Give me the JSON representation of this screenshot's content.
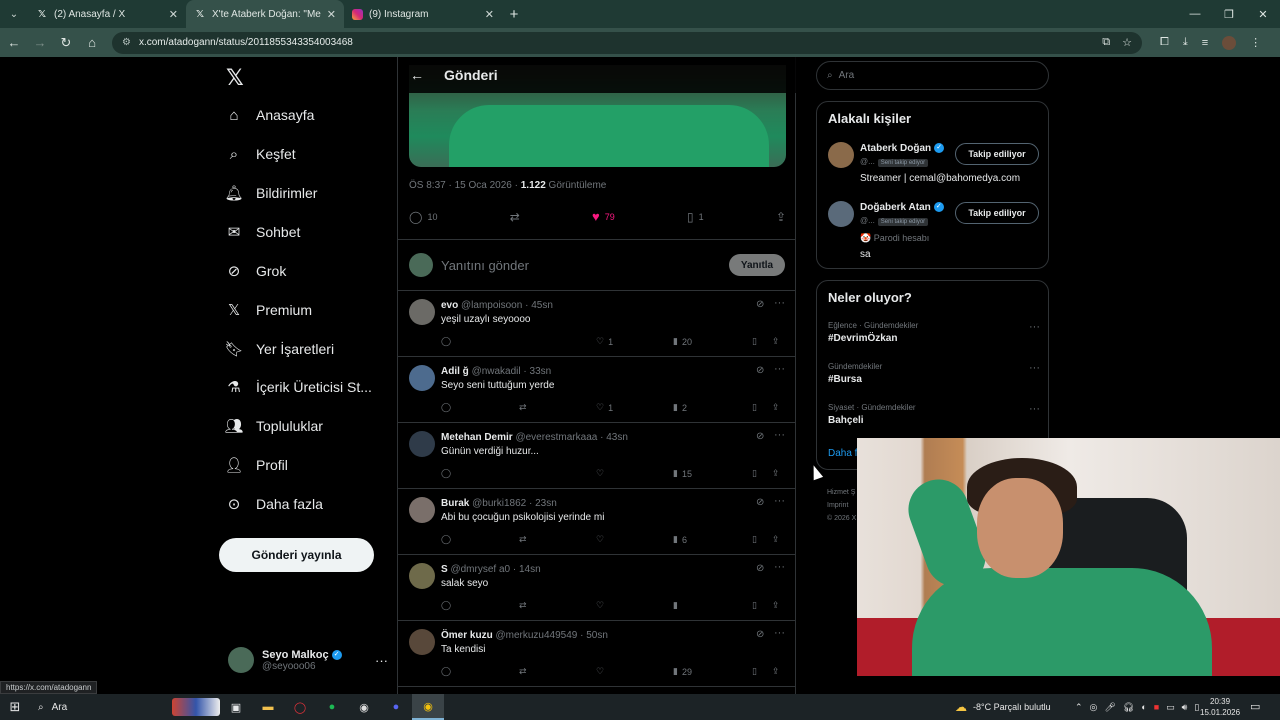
{
  "browser": {
    "tabs": [
      {
        "favicon": "x-logo-icon",
        "title": "(2) Anasayfa / X",
        "active": false
      },
      {
        "favicon": "x-logo-icon",
        "title": "X'te Ataberk Doğan: \"Meşhur A",
        "active": true
      },
      {
        "favicon": "instagram-icon",
        "title": "(9) Instagram",
        "active": false
      }
    ],
    "url": "x.com/atadogann/status/2011855343354003468"
  },
  "nav": {
    "items": [
      {
        "icon": "home-icon",
        "label": "Anasayfa"
      },
      {
        "icon": "search-icon",
        "label": "Keşfet"
      },
      {
        "icon": "bell-icon",
        "label": "Bildirimler"
      },
      {
        "icon": "mail-icon",
        "label": "Sohbet"
      },
      {
        "icon": "grok-icon",
        "label": "Grok"
      },
      {
        "icon": "x-logo-icon",
        "label": "Premium"
      },
      {
        "icon": "bookmark-icon",
        "label": "Yer İşaretleri"
      },
      {
        "icon": "flask-icon",
        "label": "İçerik Üreticisi St..."
      },
      {
        "icon": "people-icon",
        "label": "Topluluklar"
      },
      {
        "icon": "person-icon",
        "label": "Profil"
      },
      {
        "icon": "more-circle-icon",
        "label": "Daha fazla"
      }
    ],
    "post_button": "Gönderi yayınla",
    "account": {
      "name": "Seyo Malkoç",
      "handle": "@seyooo06"
    }
  },
  "main": {
    "title": "Gönderi",
    "post": {
      "time": "ÖS 8:37 · 15 Oca 2026 · ",
      "views": "1.122",
      "views_label": " Görüntüleme",
      "replies": "10",
      "likes": "79",
      "bookmarks": "1"
    },
    "reply_placeholder": "Yanıtını gönder",
    "reply_button": "Yanıtla",
    "replies": [
      {
        "name": "evo",
        "handle": "@lampoisoon · 45sn",
        "text": "yeşil uzaylı seyoooo",
        "likes": "1",
        "views": "20"
      },
      {
        "name": "Adil ğ",
        "handle": "@nwakadil · 33sn",
        "text": "Seyo seni tuttuğum yerde",
        "likes": "1",
        "views": "2"
      },
      {
        "name": "Metehan Demir",
        "handle": "@everestmarkaaa · 43sn",
        "text": "Günün verdiği huzur...",
        "likes": "",
        "views": "15"
      },
      {
        "name": "Burak",
        "handle": "@burki1862 · 23sn",
        "text": "Abi bu çocuğun psikolojisi yerinde mi",
        "likes": "",
        "views": "6"
      },
      {
        "name": "S",
        "handle": "@dmrysef a0 · 14sn",
        "text": "salak seyo",
        "likes": "",
        "views": ""
      },
      {
        "name": "Ömer kuzu",
        "handle": "@merkuzu449549 · 50sn",
        "text": "Ta kendisi",
        "likes": "",
        "views": "29"
      }
    ]
  },
  "sidebar": {
    "search_placeholder": "Ara",
    "related_title": "Alakalı kişiler",
    "people": [
      {
        "name": "Ataberk Doğan",
        "handle": "@...",
        "badge": "Seni takip ediyor",
        "button": "Takip ediliyor",
        "bio": "Streamer | cemal@bahomedya.com",
        "bio2": ""
      },
      {
        "name": "Doğaberk Atan",
        "handle": "@...",
        "badge": "Seni takip ediyor",
        "button": "Takip ediliyor",
        "bio2": "🤡 Parodi hesabı",
        "bio": "sa"
      }
    ],
    "trends_title": "Neler oluyor?",
    "trends": [
      {
        "category": "Eğlence · Gündemdekiler",
        "topic": "#DevrimÖzkan"
      },
      {
        "category": "Gündemdekiler",
        "topic": "#Bursa"
      },
      {
        "category": "Siyaset · Gündemdekiler",
        "topic": "Bahçeli"
      }
    ],
    "show_more": "Daha fazl",
    "footer": [
      "Hizmet Ş",
      "Imprint",
      "© 2026 X"
    ]
  },
  "status_url": "https://x.com/atadogann",
  "taskbar": {
    "search": "Ara",
    "weather": "-8°C  Parçalı bulutlu",
    "time": "20:39",
    "date": "15.01.2026"
  }
}
